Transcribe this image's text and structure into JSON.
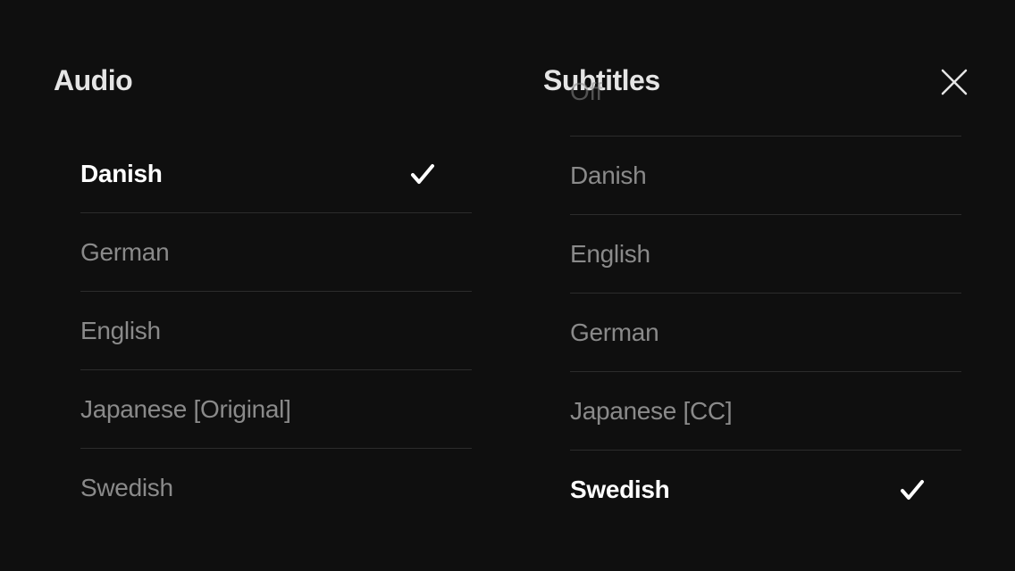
{
  "audio": {
    "heading": "Audio",
    "options": [
      {
        "label": "Danish",
        "selected": true
      },
      {
        "label": "German",
        "selected": false
      },
      {
        "label": "English",
        "selected": false
      },
      {
        "label": "Japanese [Original]",
        "selected": false
      },
      {
        "label": "Swedish",
        "selected": false
      }
    ]
  },
  "subtitles": {
    "heading": "Subtitles",
    "options": [
      {
        "label": "Off",
        "selected": false,
        "partial": true
      },
      {
        "label": "Danish",
        "selected": false
      },
      {
        "label": "English",
        "selected": false
      },
      {
        "label": "German",
        "selected": false
      },
      {
        "label": "Japanese [CC]",
        "selected": false
      },
      {
        "label": "Swedish",
        "selected": true
      }
    ]
  }
}
